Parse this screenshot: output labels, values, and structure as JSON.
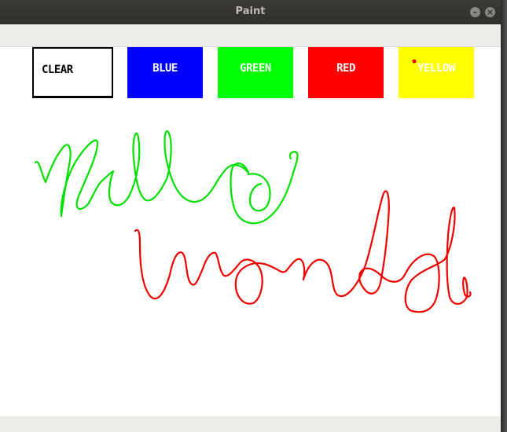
{
  "window": {
    "title": "Paint",
    "minimize_glyph": "–",
    "close_glyph": "×"
  },
  "palette": {
    "clear": {
      "label": "CLEAR",
      "bg": "#ffffff",
      "fg": "#000000"
    },
    "blue": {
      "label": "BLUE",
      "bg": "#0000ff",
      "fg": "#ffffff"
    },
    "green": {
      "label": "GREEN",
      "bg": "#00ff00",
      "fg": "#ffffff"
    },
    "red": {
      "label": "RED",
      "bg": "#ff0000",
      "fg": "#ffffff"
    },
    "yellow": {
      "label": "YELLOW",
      "bg": "#ffff00",
      "fg": "#ffffff"
    }
  },
  "strokes": {
    "green_color": "#00e000",
    "red_color": "#ee0000"
  },
  "icons": {
    "minimize": "minimize-icon",
    "close": "close-icon"
  }
}
